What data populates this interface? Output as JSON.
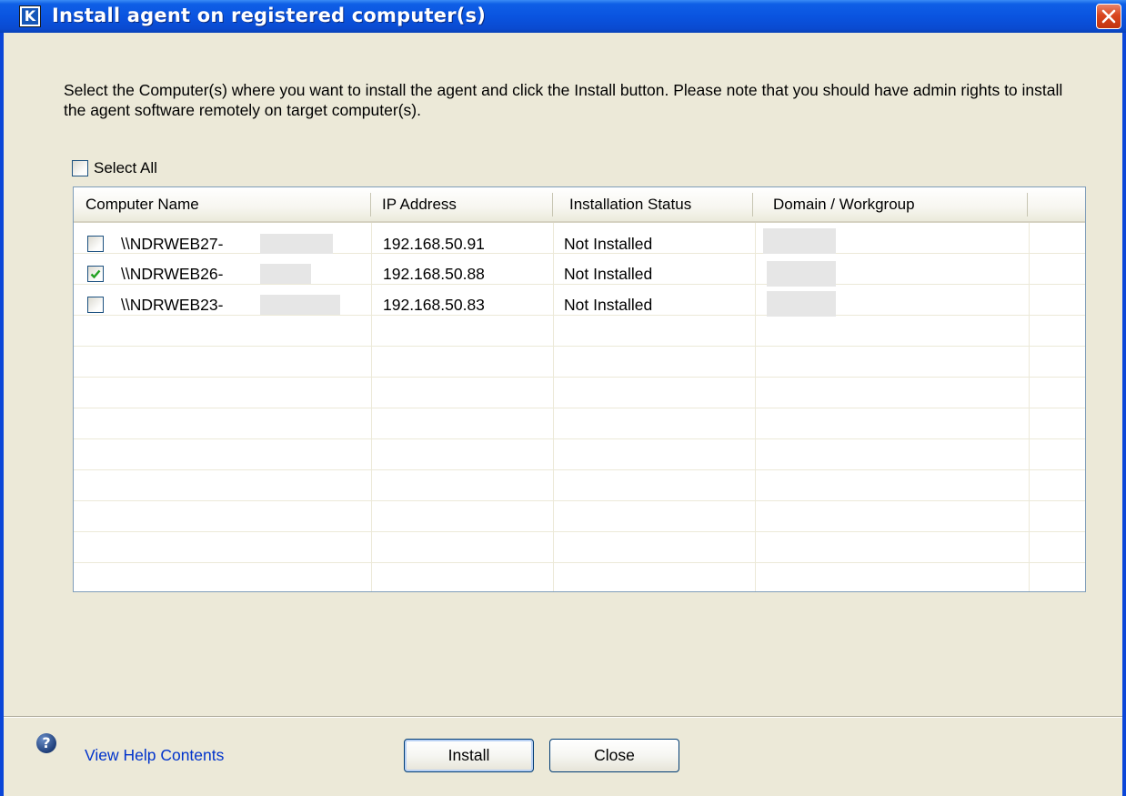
{
  "window": {
    "title": "Install agent on registered computer(s)",
    "app_icon_letter": "K",
    "close_icon": "close-icon"
  },
  "intro_text": "Select the Computer(s) where you want to install the agent and click the Install button. Please note that you should have admin rights to install the agent software remotely on target computer(s).",
  "select_all": {
    "label": "Select All",
    "checked": false
  },
  "table": {
    "columns": [
      "Computer Name",
      "IP Address",
      "Installation Status",
      "Domain / Workgroup"
    ],
    "rows": [
      {
        "checked": false,
        "computer_name": "\\\\NDRWEB27-",
        "ip": "192.168.50.91",
        "status": "Not Installed",
        "domain": ""
      },
      {
        "checked": true,
        "computer_name": "\\\\NDRWEB26-",
        "ip": "192.168.50.88",
        "status": "Not Installed",
        "domain": ""
      },
      {
        "checked": false,
        "computer_name": "\\\\NDRWEB23-",
        "ip": "192.168.50.83",
        "status": "Not Installed",
        "domain": ""
      }
    ]
  },
  "footer": {
    "help_link": "View Help Contents",
    "install_label": "Install",
    "close_label": "Close"
  },
  "colors": {
    "titlebar": "#0a54e0",
    "link": "#0033cc",
    "check": "#21a121"
  }
}
